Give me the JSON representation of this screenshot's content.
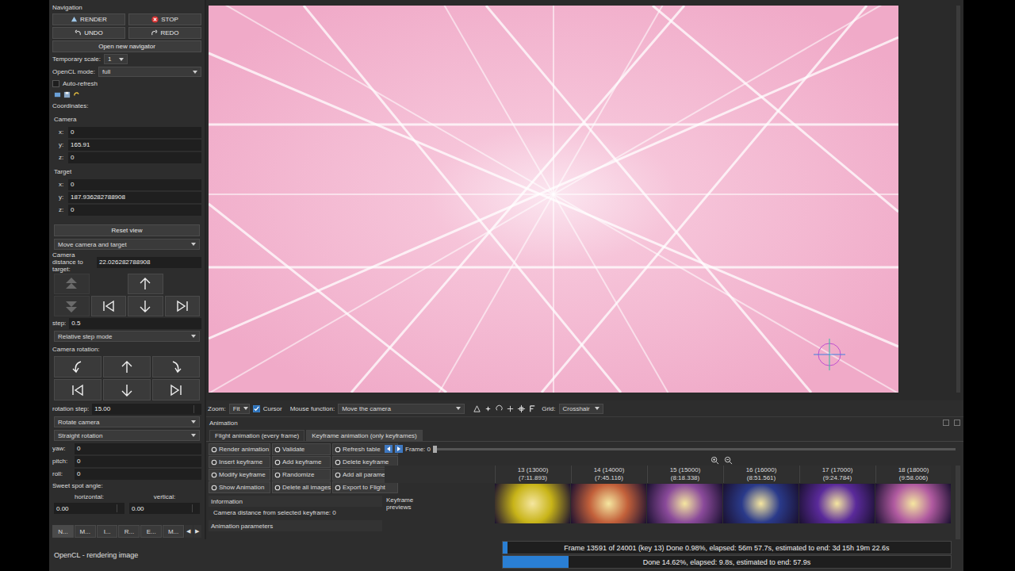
{
  "navigation": {
    "title": "Navigation",
    "action_buttons": [
      {
        "label": "RENDER"
      },
      {
        "label": "STOP"
      },
      {
        "label": "UNDO"
      },
      {
        "label": "REDO"
      }
    ],
    "open_navigator": "Open new navigator",
    "temporary_scale": {
      "label": "Temporary scale:",
      "value": "1"
    },
    "opencl_mode": {
      "label": "OpenCL mode:",
      "value": "full"
    },
    "auto_refresh": {
      "label": "Auto-refresh",
      "checked": false
    },
    "coordinates_label": "Coordinates:",
    "camera": {
      "title": "Camera",
      "fields": [
        {
          "label": "x:",
          "value": "0"
        },
        {
          "label": "y:",
          "value": "165.91"
        },
        {
          "label": "z:",
          "value": "0"
        }
      ]
    },
    "target": {
      "title": "Target",
      "fields": [
        {
          "label": "x:",
          "value": "0"
        },
        {
          "label": "y:",
          "value": "187.936282788908"
        },
        {
          "label": "z:",
          "value": "0"
        }
      ]
    },
    "reset_view": "Reset view",
    "move_mode": "Move camera and target",
    "distance": {
      "label": "Camera distance to target:",
      "value": "22.026282788908"
    },
    "move_buttons": [
      {
        "disabled": true
      },
      {
        "disabled": false
      },
      {
        "disabled": true
      },
      {
        "disabled": false
      },
      {
        "disabled": false
      },
      {
        "disabled": false
      }
    ],
    "step": {
      "label": "step:",
      "value": "0.5"
    },
    "step_mode": "Relative step mode",
    "rotation_label": "Camera rotation:",
    "rotation_step": {
      "label": "rotation step:",
      "value": "15.00"
    },
    "rotate_mode": "Rotate camera",
    "rotation_type": "Straight rotation",
    "angles": [
      {
        "label": "yaw:",
        "value": "0"
      },
      {
        "label": "pitch:",
        "value": "0"
      },
      {
        "label": "roll:",
        "value": "0"
      }
    ],
    "sweet_spot": {
      "label": "Sweet spot angle:",
      "horizontal": {
        "label": "horizontal:",
        "value": "0.00"
      },
      "vertical": {
        "label": "vertical:",
        "value": "0.00"
      }
    },
    "tabs": [
      {
        "label": "N...",
        "selected": true
      },
      {
        "label": "M...",
        "selected": false
      },
      {
        "label": "I...",
        "selected": false
      },
      {
        "label": "R...",
        "selected": false
      },
      {
        "label": "E...",
        "selected": false
      },
      {
        "label": "M...",
        "selected": false
      }
    ],
    "tab_scroll": [
      "◀",
      "▶"
    ]
  },
  "image_toolbar": {
    "zoom_label": "Zoom:",
    "zoom": "Fit",
    "cursor": {
      "label": "Cursor",
      "checked": true
    },
    "mouse_label": "Mouse function:",
    "mouse_function": "Move the camera",
    "grid_label": "Grid:",
    "grid": "Crosshair"
  },
  "animation": {
    "title": "Animation",
    "tabs": [
      {
        "label": "Flight animation (every frame)",
        "selected": false
      },
      {
        "label": "Keyframe animation (only keyframes)",
        "selected": true
      }
    ],
    "buttons": [
      "Render animation",
      "Validate",
      "Refresh table",
      "Insert keyframe",
      "Add keyframe",
      "Delete keyframe",
      "Modify keyframe",
      "Randomize",
      "Add all parameters",
      "Show Animation",
      "Delete all images",
      "Export to Flight"
    ],
    "information_title": "Information",
    "information": "Camera distance from selected keyframe: 0",
    "parameters_title": "Animation parameters",
    "frame": {
      "label": "Frame: 0",
      "level": 0
    },
    "row_label": "Keyframe previews",
    "keyframes": [
      {
        "title": "13 (13000)",
        "time": "(7:11.893)",
        "color": "#c8b418"
      },
      {
        "title": "14 (14000)",
        "time": "(7:45.116)",
        "color": "#c2603a"
      },
      {
        "title": "15 (15000)",
        "time": "(8:18.338)",
        "color": "#8a4a9a"
      },
      {
        "title": "16 (16000)",
        "time": "(8:51.561)",
        "color": "#2a3a8a"
      },
      {
        "title": "17 (17000)",
        "time": "(9:24.784)",
        "color": "#5a2a9a"
      },
      {
        "title": "18 (18000)",
        "time": "(9:58.006)",
        "color": "#b05aa0"
      }
    ]
  },
  "status_bar": {
    "text": "OpenCL - rendering image",
    "progress": [
      {
        "text": "Frame 13591 of 24001 (key 13) Done 0.98%, elapsed: 56m 57.7s, estimated to end: 3d 15h 19m 22.6s",
        "level": 0.0098
      },
      {
        "text": "Done 14.62%, elapsed: 9.8s, estimated to end: 57.9s",
        "level": 0.1462
      }
    ]
  }
}
